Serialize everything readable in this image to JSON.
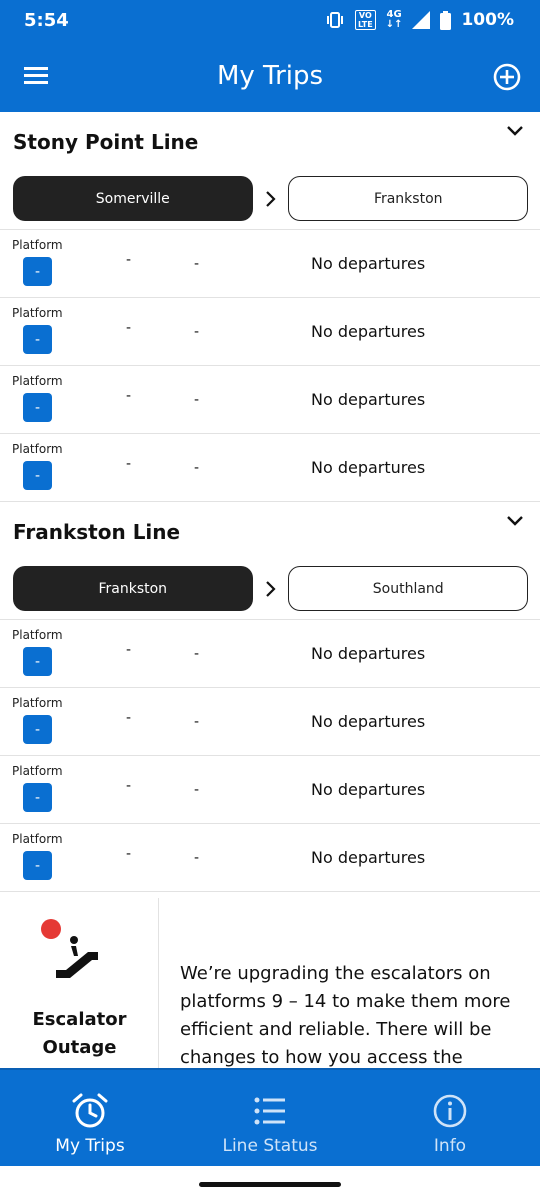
{
  "status_bar": {
    "time": "5:54",
    "volte": "VO\nLTE",
    "network": "4G",
    "battery": "100%"
  },
  "app_bar": {
    "title": "My Trips",
    "menu_icon": "hamburger-menu-icon",
    "add_icon": "add-circle-icon"
  },
  "lines": [
    {
      "name": "Stony Point Line",
      "from_station": "Somerville",
      "to_station": "Frankston",
      "departures": [
        {
          "platform_label": "Platform",
          "platform": "-",
          "col1": "-",
          "col2": "-",
          "status": "No departures"
        },
        {
          "platform_label": "Platform",
          "platform": "-",
          "col1": "-",
          "col2": "-",
          "status": "No departures"
        },
        {
          "platform_label": "Platform",
          "platform": "-",
          "col1": "-",
          "col2": "-",
          "status": "No departures"
        },
        {
          "platform_label": "Platform",
          "platform": "-",
          "col1": "-",
          "col2": "-",
          "status": "No departures"
        }
      ]
    },
    {
      "name": "Frankston Line",
      "from_station": "Frankston",
      "to_station": "Southland",
      "departures": [
        {
          "platform_label": "Platform",
          "platform": "-",
          "col1": "-",
          "col2": "-",
          "status": "No departures"
        },
        {
          "platform_label": "Platform",
          "platform": "-",
          "col1": "-",
          "col2": "-",
          "status": "No departures"
        },
        {
          "platform_label": "Platform",
          "platform": "-",
          "col1": "-",
          "col2": "-",
          "status": "No departures"
        },
        {
          "platform_label": "Platform",
          "platform": "-",
          "col1": "-",
          "col2": "-",
          "status": "No departures"
        }
      ]
    }
  ],
  "outage": {
    "title_line1": "Escalator",
    "title_line2": "Outage",
    "message": "We’re upgrading the escalators on platforms 9 – 14 to make them more efficient and reliable. There will be changes to how you access the station"
  },
  "bottom_nav": [
    {
      "label": "My Trips",
      "icon": "alarm-clock-icon",
      "active": true
    },
    {
      "label": "Line Status",
      "icon": "list-icon",
      "active": false
    },
    {
      "label": "Info",
      "icon": "info-icon",
      "active": false
    }
  ],
  "colors": {
    "primary": "#0a6fd1",
    "dark_pill": "#222222",
    "alert_dot": "#e53935"
  }
}
